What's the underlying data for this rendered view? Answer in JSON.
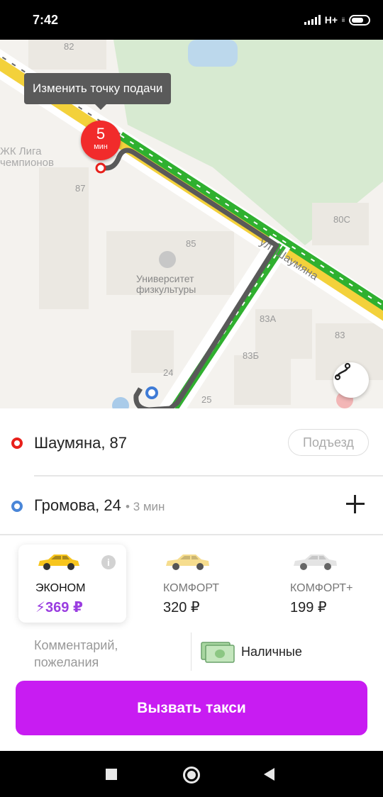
{
  "status_bar": {
    "time": "7:42",
    "network": "H+",
    "network_suffix": "іі"
  },
  "map": {
    "tooltip": "Изменить точку подачи",
    "eta_number": "5",
    "eta_unit": "мин",
    "street_label": "ул. Шаумяна",
    "labels": {
      "b82": "82",
      "b87": "87",
      "b85": "85",
      "b80c": "80С",
      "b83a": "83А",
      "b83": "83",
      "b83b": "83Б",
      "b24": "24",
      "b25": "25",
      "zhk1": "ЖК Лига",
      "zhk2": "чемпионов",
      "uni1": "Университет",
      "uni2": "физкультуры"
    }
  },
  "pickup": {
    "address": "Шаумяна, 87",
    "entrance_label": "Подъезд",
    "dot_color": "#e8201b"
  },
  "destination": {
    "address": "Громова, 24",
    "eta": "• 3 мин",
    "dot_color": "#4a86d8"
  },
  "tariffs": [
    {
      "name": "ЭКОНОМ",
      "price": "369 ₽",
      "selected": true,
      "car_color": "#f7c51d",
      "surge": true
    },
    {
      "name": "КОМФОРТ",
      "price": "320 ₽",
      "selected": false,
      "car_color": "#f6dd8e"
    },
    {
      "name": "КОМФОРТ+",
      "price": "199 ₽",
      "selected": false,
      "car_color": "#e4e4e4"
    }
  ],
  "comment_line1": "Комментарий,",
  "comment_line2": "пожелания",
  "payment": {
    "label": "Наличные"
  },
  "order_button": "Вызвать такси",
  "colors": {
    "accent": "#c81cf2",
    "price_highlight": "#9a3de0",
    "eta_pin": "#f12b2b"
  }
}
